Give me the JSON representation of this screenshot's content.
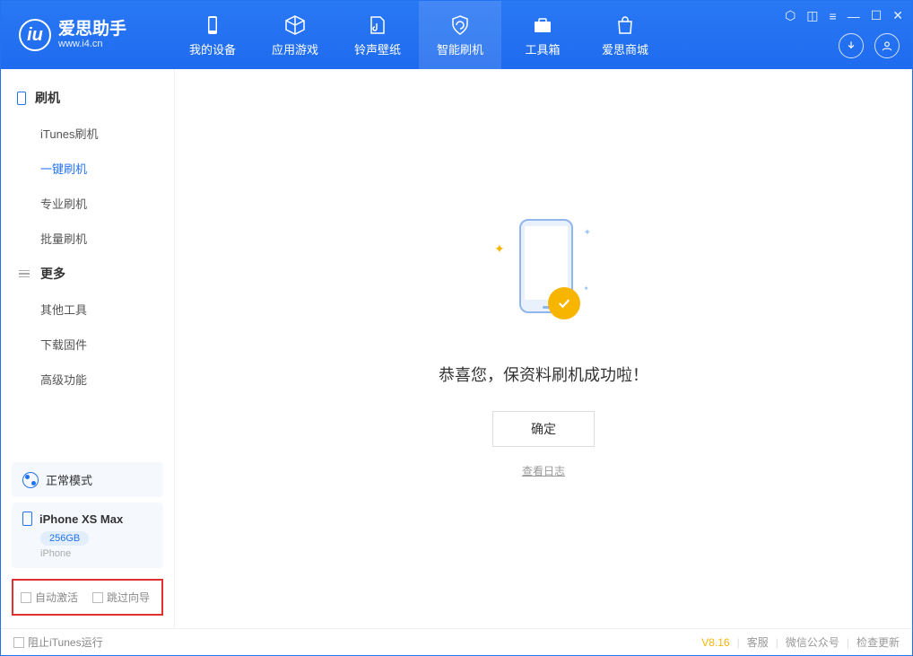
{
  "logo": {
    "title": "爱思助手",
    "subtitle": "www.i4.cn"
  },
  "nav": [
    {
      "label": "我的设备"
    },
    {
      "label": "应用游戏"
    },
    {
      "label": "铃声壁纸"
    },
    {
      "label": "智能刷机"
    },
    {
      "label": "工具箱"
    },
    {
      "label": "爱思商城"
    }
  ],
  "sidebar": {
    "section1": {
      "title": "刷机",
      "items": [
        "iTunes刷机",
        "一键刷机",
        "专业刷机",
        "批量刷机"
      ]
    },
    "section2": {
      "title": "更多",
      "items": [
        "其他工具",
        "下载固件",
        "高级功能"
      ]
    },
    "mode": "正常模式",
    "device": {
      "name": "iPhone XS Max",
      "capacity": "256GB",
      "type": "iPhone"
    },
    "checkbox1": "自动激活",
    "checkbox2": "跳过向导"
  },
  "main": {
    "success": "恭喜您，保资料刷机成功啦！",
    "ok": "确定",
    "log": "查看日志"
  },
  "footer": {
    "block_itunes": "阻止iTunes运行",
    "version": "V8.16",
    "support": "客服",
    "wechat": "微信公众号",
    "update": "检查更新"
  }
}
